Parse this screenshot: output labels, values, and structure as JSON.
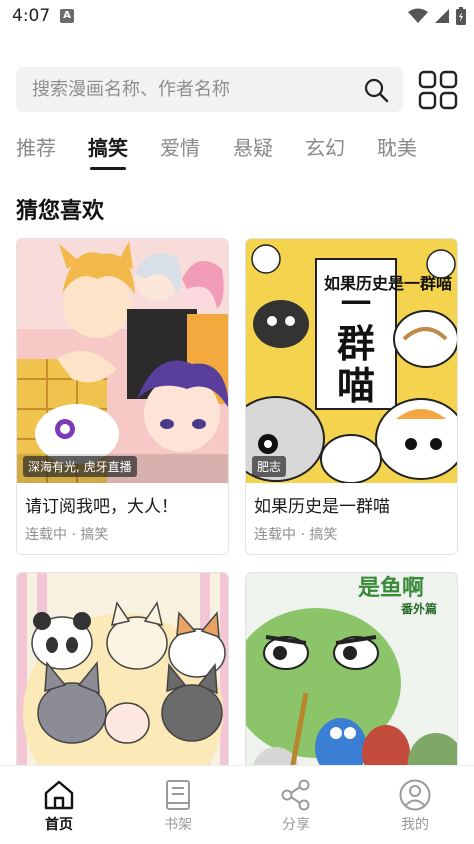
{
  "status": {
    "time": "4:07",
    "notif_letter": "A"
  },
  "search": {
    "placeholder": "搜索漫画名称、作者名称"
  },
  "tabs": [
    {
      "label": "推荐"
    },
    {
      "label": "搞笑"
    },
    {
      "label": "爱情"
    },
    {
      "label": "悬疑"
    },
    {
      "label": "玄幻"
    },
    {
      "label": "耽美"
    }
  ],
  "active_tab": "搞笑",
  "section": {
    "title": "猜您喜欢"
  },
  "comics": [
    {
      "title": "请订阅我吧，大人！",
      "meta": "连载中 · 搞笑",
      "badge": "深海有光, 虎牙直播"
    },
    {
      "title": "如果历史是一群喵",
      "meta": "连载中 · 搞笑",
      "badge": "肥志",
      "cover_text": "如果历史是一群喵"
    },
    {
      "title": "",
      "meta": "",
      "badge": ""
    },
    {
      "title": "",
      "meta": "",
      "badge": "",
      "cover_text": "是鱼啊",
      "cover_subtext": "番外篇"
    }
  ],
  "bottom_nav": [
    {
      "label": "首页"
    },
    {
      "label": "书架"
    },
    {
      "label": "分享"
    },
    {
      "label": "我的"
    }
  ],
  "colors": {
    "accent": "#1a1a1a",
    "muted": "#8a8a8a",
    "search_bg": "#f2f2f2"
  }
}
